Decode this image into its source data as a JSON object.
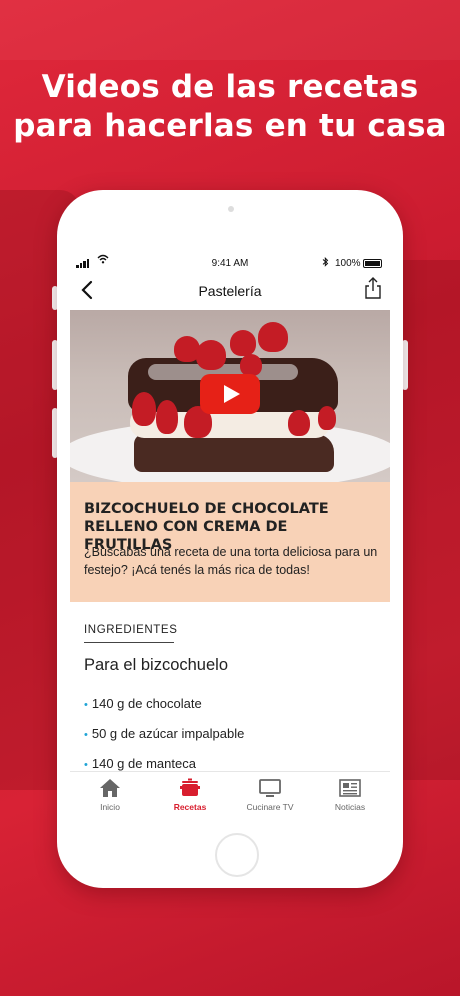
{
  "headline": {
    "line1": "Videos de las recetas",
    "line2": "para hacerlas en tu casa"
  },
  "status_bar": {
    "time": "9:41 AM",
    "battery": "100%"
  },
  "nav": {
    "title": "Pastelería"
  },
  "recipe": {
    "title": "BIZCOCHUELO DE CHOCOLATE RELLENO CON CREMA DE FRUTILLAS",
    "description": "¿Buscabas una receta de una torta deliciosa para un festejo? ¡Acá tenés la más rica de todas!"
  },
  "ingredients": {
    "label": "INGREDIENTES",
    "section": "Para el bizcochuelo",
    "items": [
      "140 g de chocolate",
      "50 g de azúcar impalpable",
      "140 g de manteca"
    ]
  },
  "tabs": [
    {
      "label": "Inicio",
      "icon": "home-icon"
    },
    {
      "label": "Recetas",
      "icon": "pot-icon",
      "active": true
    },
    {
      "label": "Cucinare TV",
      "icon": "tv-icon"
    },
    {
      "label": "Noticias",
      "icon": "newspaper-icon"
    }
  ],
  "colors": {
    "brand_red": "#d81e2e",
    "accent_peach": "#f8d2b7",
    "bullet_blue": "#1fa4d6"
  }
}
